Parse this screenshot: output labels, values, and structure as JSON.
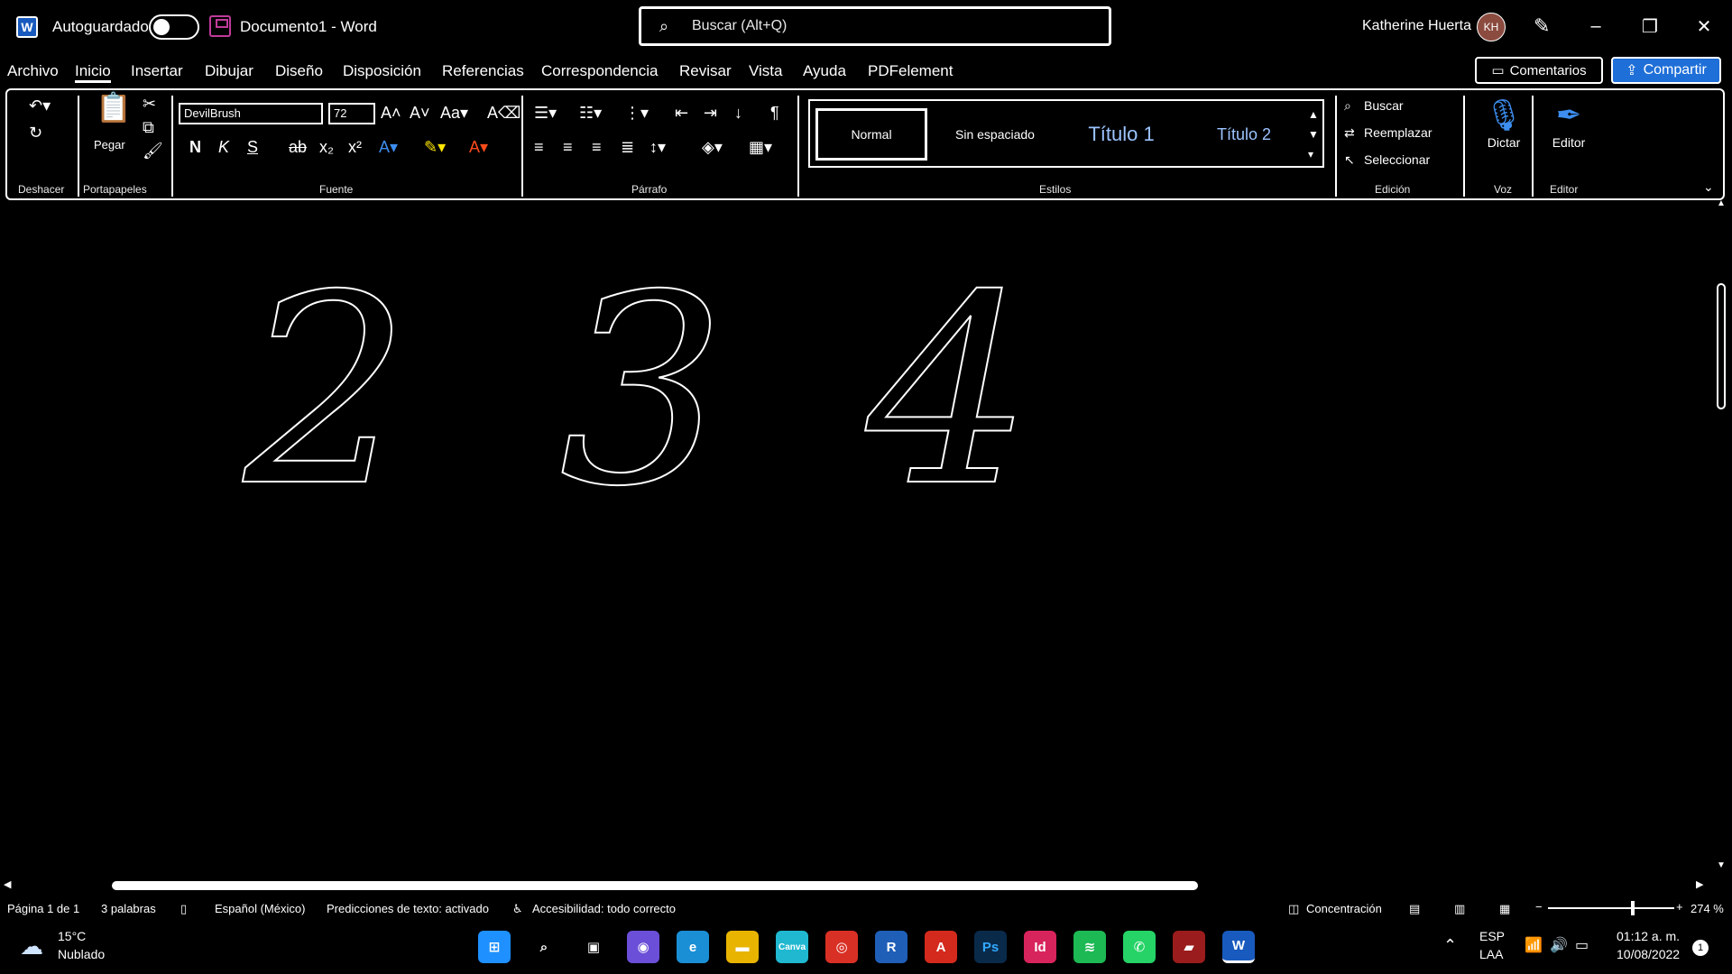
{
  "titlebar": {
    "app_logo": "W",
    "autosave_label": "Autoguardado",
    "document_title": "Documento1 - Word",
    "search_placeholder": "Buscar (Alt+Q)",
    "user_name": "Katherine Huerta",
    "user_initials": "KH",
    "minimize": "–",
    "restore": "❐",
    "close": "✕"
  },
  "tabs": [
    "Archivo",
    "Inicio",
    "Insertar",
    "Dibujar",
    "Diseño",
    "Disposición",
    "Referencias",
    "Correspondencia",
    "Revisar",
    "Vista",
    "Ayuda",
    "PDFelement"
  ],
  "active_tab": "Inicio",
  "actions": {
    "comments": "Comentarios",
    "share": "Compartir"
  },
  "ribbon": {
    "groups": {
      "undo": "Deshacer",
      "clipboard": "Portapapeles",
      "font": "Fuente",
      "paragraph": "Párrafo",
      "styles": "Estilos",
      "editing": "Edición",
      "voice": "Voz",
      "editor": "Editor"
    },
    "paste_label": "Pegar",
    "font_name": "DevilBrush",
    "font_size": "72",
    "format_buttons": {
      "bold": "N",
      "italic": "K",
      "underline": "S",
      "strike": "ab",
      "sub": "x₂",
      "sup": "x²"
    },
    "styles": [
      "Normal",
      "Sin espaciado",
      "Título 1",
      "Título 2"
    ],
    "editing": {
      "find": "Buscar",
      "replace": "Reemplazar",
      "select": "Seleccionar"
    },
    "dictate": "Dictar",
    "editor_btn": "Editor"
  },
  "document": {
    "digits": [
      "2",
      "3",
      "4"
    ]
  },
  "statusbar": {
    "page": "Página 1 de 1",
    "words": "3 palabras",
    "language": "Español (México)",
    "predictions": "Predicciones de texto: activado",
    "accessibility": "Accesibilidad: todo correcto",
    "focus": "Concentración",
    "zoom": "274 %"
  },
  "taskbar": {
    "weather_temp": "15°C",
    "weather_desc": "Nublado",
    "apps": [
      {
        "name": "start",
        "label": "⊞",
        "color": "#1e90ff"
      },
      {
        "name": "search",
        "label": "⌕",
        "color": "#000000"
      },
      {
        "name": "task-view",
        "label": "▣",
        "color": "#000000"
      },
      {
        "name": "chat",
        "label": "◉",
        "color": "#6b4fd8"
      },
      {
        "name": "edge",
        "label": "e",
        "color": "#1a8fd6"
      },
      {
        "name": "explorer",
        "label": "▬",
        "color": "#e8b400"
      },
      {
        "name": "canva",
        "label": "Canva",
        "color": "#20b8d0"
      },
      {
        "name": "chrome",
        "label": "◎",
        "color": "#d93025"
      },
      {
        "name": "revit",
        "label": "R",
        "color": "#1f5fb8"
      },
      {
        "name": "acrobat",
        "label": "A",
        "color": "#d42a1e"
      },
      {
        "name": "photoshop",
        "label": "Ps",
        "color": "#0a2a4a"
      },
      {
        "name": "indesign",
        "label": "Id",
        "color": "#d8245c"
      },
      {
        "name": "spotify",
        "label": "≋",
        "color": "#1db954"
      },
      {
        "name": "whatsapp",
        "label": "✆",
        "color": "#25d366"
      },
      {
        "name": "app-red",
        "label": "▰",
        "color": "#9b1c1c"
      },
      {
        "name": "word",
        "label": "W",
        "color": "#185abd"
      }
    ],
    "lang_top": "ESP",
    "lang_bottom": "LAA",
    "time": "01:12 a. m.",
    "date": "10/08/2022",
    "notifications": "1"
  }
}
